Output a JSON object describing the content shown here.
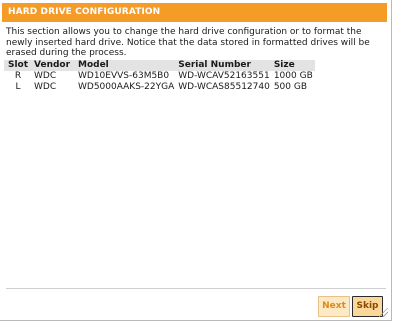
{
  "dialog": {
    "title": "HARD DRIVE CONFIGURATION",
    "description": "This section allows you to change the hard drive configuration or to format the newly inserted hard drive. Notice that the data stored in formatted drives will be erased during the process."
  },
  "table": {
    "headers": [
      "Slot",
      "Vendor",
      "Model",
      "Serial Number",
      "Size"
    ],
    "rows": [
      [
        "R",
        "WDC",
        "WD10EVVS-63M5B0",
        "WD-WCAV52163551",
        "1000 GB"
      ],
      [
        "L",
        "WDC",
        "WD5000AAKS-22YGA",
        "WD-WCAS85512740",
        "500 GB"
      ]
    ]
  },
  "buttons": {
    "next_label": "Next",
    "skip_label": "Skip"
  },
  "colors": {
    "header_bg": "#f49c27",
    "button_next_bg": "#fde9c4",
    "button_skip_bg": "#fcd79a"
  }
}
